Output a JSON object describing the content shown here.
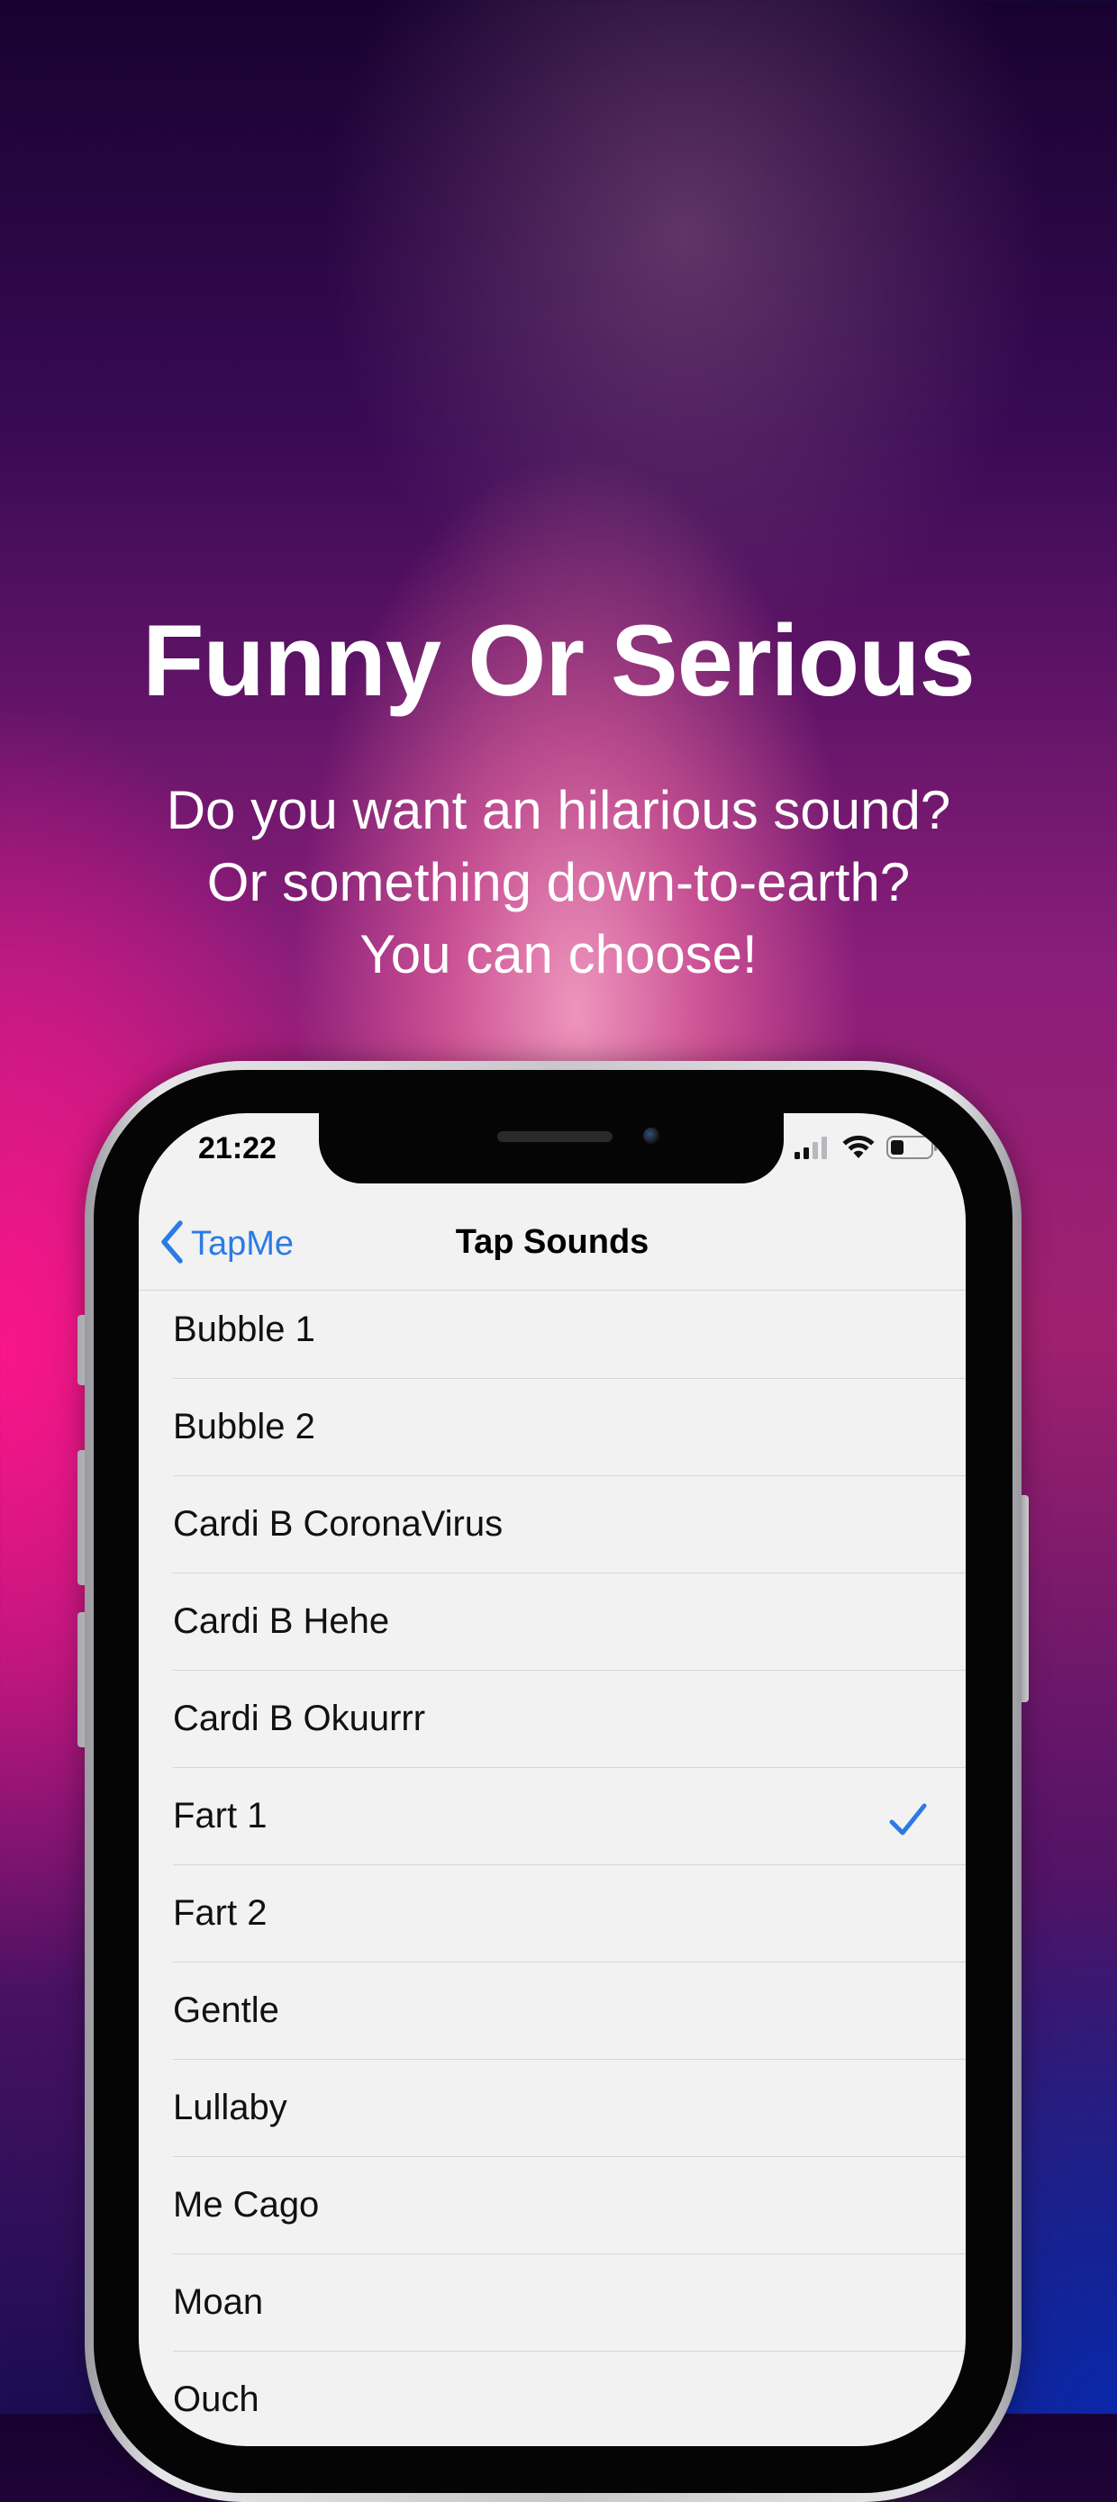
{
  "headline": "Funny Or Serious",
  "subheadline": [
    "Do you want an hilarious sound?",
    "Or something down-to-earth?",
    "You can choose!"
  ],
  "status_bar": {
    "time": "21:22",
    "icons": [
      "cellular-signal-icon",
      "wifi-icon",
      "battery-icon"
    ]
  },
  "nav": {
    "back_label": "TapMe",
    "title": "Tap Sounds"
  },
  "sounds": [
    {
      "label": "Bubble 1",
      "selected": false
    },
    {
      "label": "Bubble 2",
      "selected": false
    },
    {
      "label": "Cardi B CoronaVirus",
      "selected": false
    },
    {
      "label": "Cardi B Hehe",
      "selected": false
    },
    {
      "label": "Cardi B Okuurrr",
      "selected": false
    },
    {
      "label": "Fart 1",
      "selected": true
    },
    {
      "label": "Fart 2",
      "selected": false
    },
    {
      "label": "Gentle",
      "selected": false
    },
    {
      "label": "Lullaby",
      "selected": false
    },
    {
      "label": "Me Cago",
      "selected": false
    },
    {
      "label": "Moan",
      "selected": false
    },
    {
      "label": "Ouch",
      "selected": false
    }
  ],
  "colors": {
    "accent": "#2c7be5",
    "screen_background": "#f2f2f2"
  }
}
